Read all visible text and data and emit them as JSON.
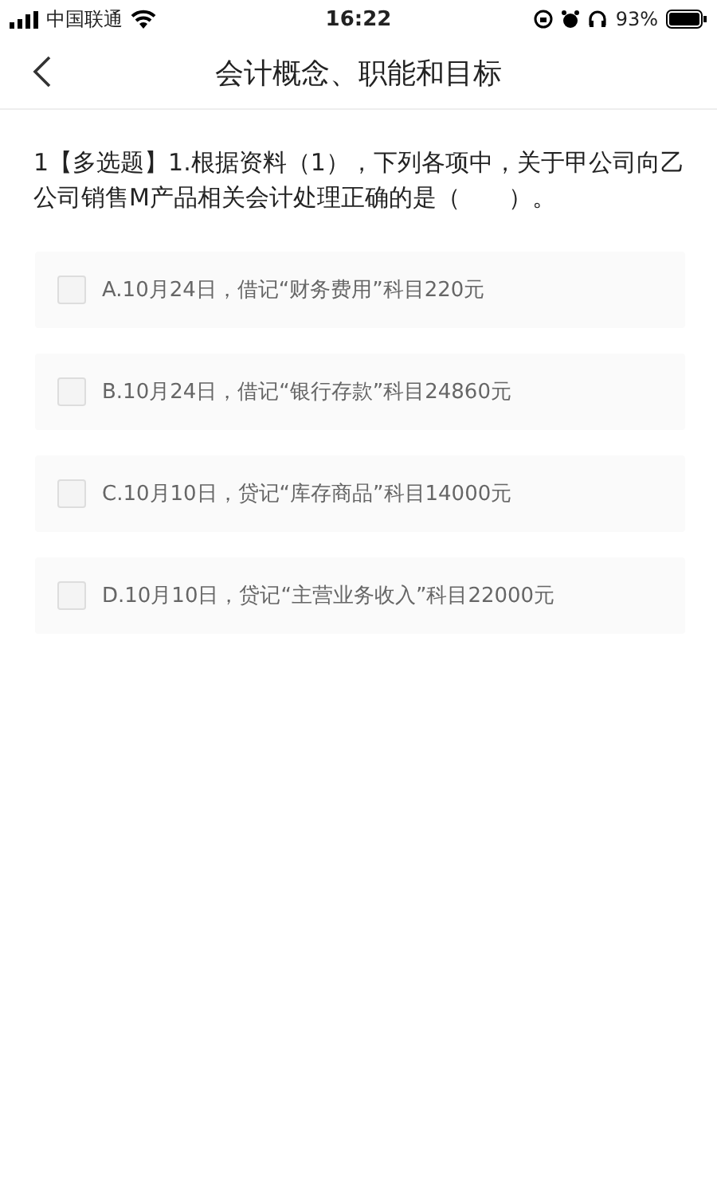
{
  "status_bar": {
    "carrier": "中国联通",
    "time": "16:22",
    "battery": "93%"
  },
  "nav": {
    "title": "会计概念、职能和目标"
  },
  "question": {
    "number": "1",
    "type": "【多选题】",
    "text": "1.根据资料（1），下列各项中，关于甲公司向乙公司销售M产品相关会计处理正确的是（　　）。"
  },
  "options": [
    {
      "text": "A.10月24日，借记“财务费用”科目220元",
      "checked": false
    },
    {
      "text": "B.10月24日，借记“银行存款”科目24860元",
      "checked": false
    },
    {
      "text": "C.10月10日，贷记“库存商品”科目14000元",
      "checked": false
    },
    {
      "text": "D.10月10日，贷记“主营业务收入”科目22000元",
      "checked": false
    }
  ]
}
